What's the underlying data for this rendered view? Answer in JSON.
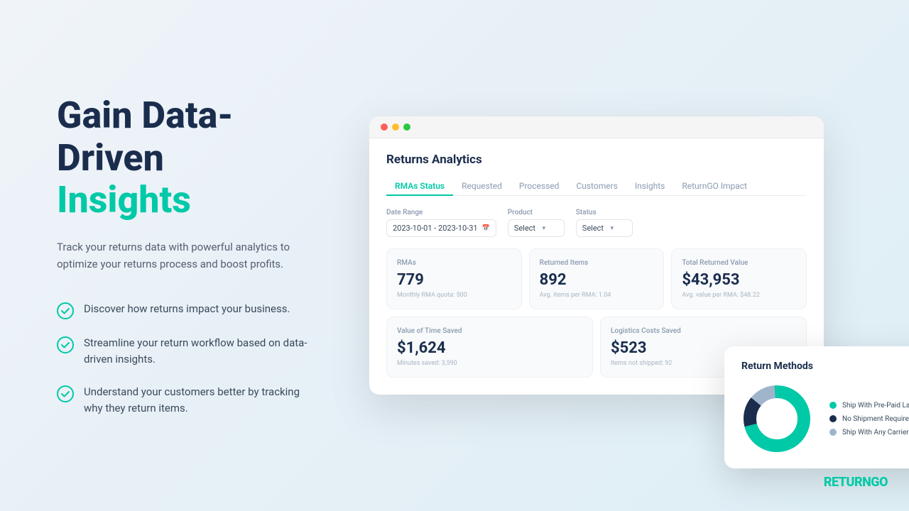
{
  "headline": {
    "line1": "Gain Data-Driven",
    "line2": "Insights"
  },
  "subtitle": "Track your returns data with powerful analytics to optimize your returns process and boost profits.",
  "features": [
    {
      "text": "Discover how returns impact your business."
    },
    {
      "text": "Streamline your return workflow based on data-driven insights."
    },
    {
      "text": "Understand your customers better by tracking why they return items."
    }
  ],
  "browser": {
    "title": "Returns Analytics",
    "tabs": [
      "RMAs Status",
      "Requested",
      "Processed",
      "Customers",
      "Insights",
      "ReturnGO Impact"
    ],
    "active_tab": "RMAs Status",
    "filters": {
      "date_range_label": "Date Range",
      "date_range_value": "2023-10-01 - 2023-10-31",
      "product_label": "Product",
      "product_value": "Select",
      "status_label": "Status",
      "status_value": "Select"
    },
    "stats": [
      {
        "label": "RMAs",
        "value": "779",
        "sub": "Monthly RMA quota: 500"
      },
      {
        "label": "Returned Items",
        "value": "892",
        "sub": "Avg. items per RMA: 1.04"
      },
      {
        "label": "Total Returned Value",
        "value": "$43,953",
        "sub": "Avg. value per RMA: $48.22"
      }
    ],
    "stats2": [
      {
        "label": "Value of Time Saved",
        "value": "$1,624",
        "sub": "Minutes saved: 3,590"
      },
      {
        "label": "Logistics Costs Saved",
        "value": "$523",
        "sub": "Items not shipped: 92"
      }
    ]
  },
  "return_methods": {
    "title": "Return Methods",
    "legend": [
      {
        "label": "Ship With Pre-Paid Label",
        "color": "#00c9a7"
      },
      {
        "label": "No Shipment Required",
        "color": "#1a2d4d"
      },
      {
        "label": "Ship With Any Carrier",
        "color": "#a0b4cc"
      }
    ],
    "donut": {
      "teal_pct": 72,
      "dark_pct": 15,
      "light_pct": 13
    }
  },
  "logo": {
    "text1": "RETURN",
    "text2": "GO"
  }
}
